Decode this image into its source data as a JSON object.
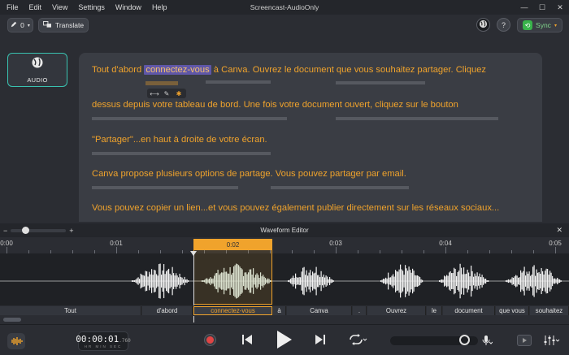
{
  "window": {
    "title": "Screencast-AudioOnly",
    "menu": [
      "File",
      "Edit",
      "View",
      "Settings",
      "Window",
      "Help"
    ],
    "controls": {
      "minimize": "—",
      "maximize": "☐",
      "close": "✕"
    }
  },
  "toolbar": {
    "edit_count": "0",
    "translate_label": "Translate",
    "help_label": "?",
    "sync_label": "Sync"
  },
  "left_panel": {
    "tile_label": "AUDIO"
  },
  "transcript": {
    "line1_before": "Tout d'abord ",
    "line1_highlight": "connectez-vous",
    "line1_after": " à Canva. Ouvrez le document que vous souhaitez partager. Cliquez",
    "line2": "dessus depuis votre tableau de bord. Une fois votre document ouvert, cliquez sur le bouton",
    "line3": "\"Partager\"...en haut à droite de votre écran.",
    "line4": "Canva propose plusieurs options de partage. Vous pouvez partager par email.",
    "line5": "Vous pouvez copier un lien...et vous pouvez également publier directement sur les réseaux sociaux..."
  },
  "waveform_editor": {
    "title": "Waveform Editor",
    "zoom_minus": "−",
    "zoom_plus": "+",
    "close": "✕",
    "ruler_labels": [
      "0:00",
      "0:01",
      "0:02",
      "0:03",
      "0:04",
      "0:05"
    ],
    "selection_label": "0:02",
    "words": [
      {
        "text": "Tout"
      },
      {
        "text": "d'abord"
      },
      {
        "text": "connectez-vous",
        "selected": true
      },
      {
        "text": "à"
      },
      {
        "text": "Canva"
      },
      {
        "text": "."
      },
      {
        "text": "Ouvrez"
      },
      {
        "text": "le"
      },
      {
        "text": "document"
      },
      {
        "text": "que vous"
      },
      {
        "text": "souhaitez"
      }
    ]
  },
  "transport": {
    "timecode": "00:00:01",
    "frames": ".760",
    "units": "HR MIN SEC"
  },
  "colors": {
    "accent": "#f0a32c",
    "highlight": "#5f57a8",
    "tile_border": "#39c2b0",
    "record": "#e04545",
    "sync_green": "#38b34a"
  }
}
